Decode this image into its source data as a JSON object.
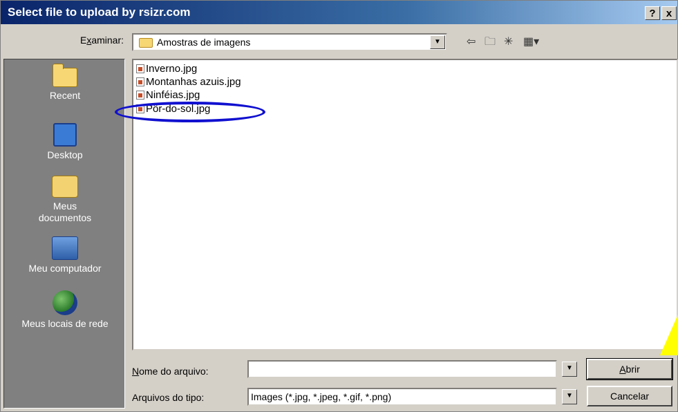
{
  "window": {
    "title": "Select file to upload by rsizr.com",
    "help_label": "?",
    "close_label": "x"
  },
  "lookin": {
    "label_prefix": "E",
    "label_underlined": "x",
    "label_suffix": "aminar:",
    "value": "Amostras de imagens"
  },
  "toolbar": {
    "back_icon": "back-arrow-icon",
    "up_icon": "up-folder-icon",
    "newfolder_icon": "new-folder-icon",
    "views_icon": "views-menu-icon"
  },
  "places": [
    {
      "label": "Recent",
      "icon": "recent-folder-icon"
    },
    {
      "label": "Desktop",
      "icon": "desktop-icon"
    },
    {
      "label": "Meus documentos",
      "icon": "my-documents-icon"
    },
    {
      "label": "Meu computador",
      "icon": "my-computer-icon"
    },
    {
      "label": "Meus locais de rede",
      "icon": "network-places-icon"
    }
  ],
  "files": [
    {
      "name": "Inverno.jpg"
    },
    {
      "name": "Montanhas azuis.jpg"
    },
    {
      "name": "Ninféias.jpg"
    },
    {
      "name": "Pôr-do-sol.jpg"
    }
  ],
  "filename": {
    "label_underlined": "N",
    "label_suffix": "ome do arquivo:",
    "value": ""
  },
  "filetype": {
    "label": "Arquivos do tipo:",
    "value": "Images (*.jpg, *.jpeg, *.gif, *.png)"
  },
  "buttons": {
    "open_underlined": "A",
    "open_suffix": "brir",
    "cancel": "Cancelar"
  },
  "colors": {
    "titlebar_start": "#0a246a",
    "places_bg": "#808080",
    "annotation_ellipse": "#1010d0",
    "annotation_triangle": "#ffff00"
  }
}
